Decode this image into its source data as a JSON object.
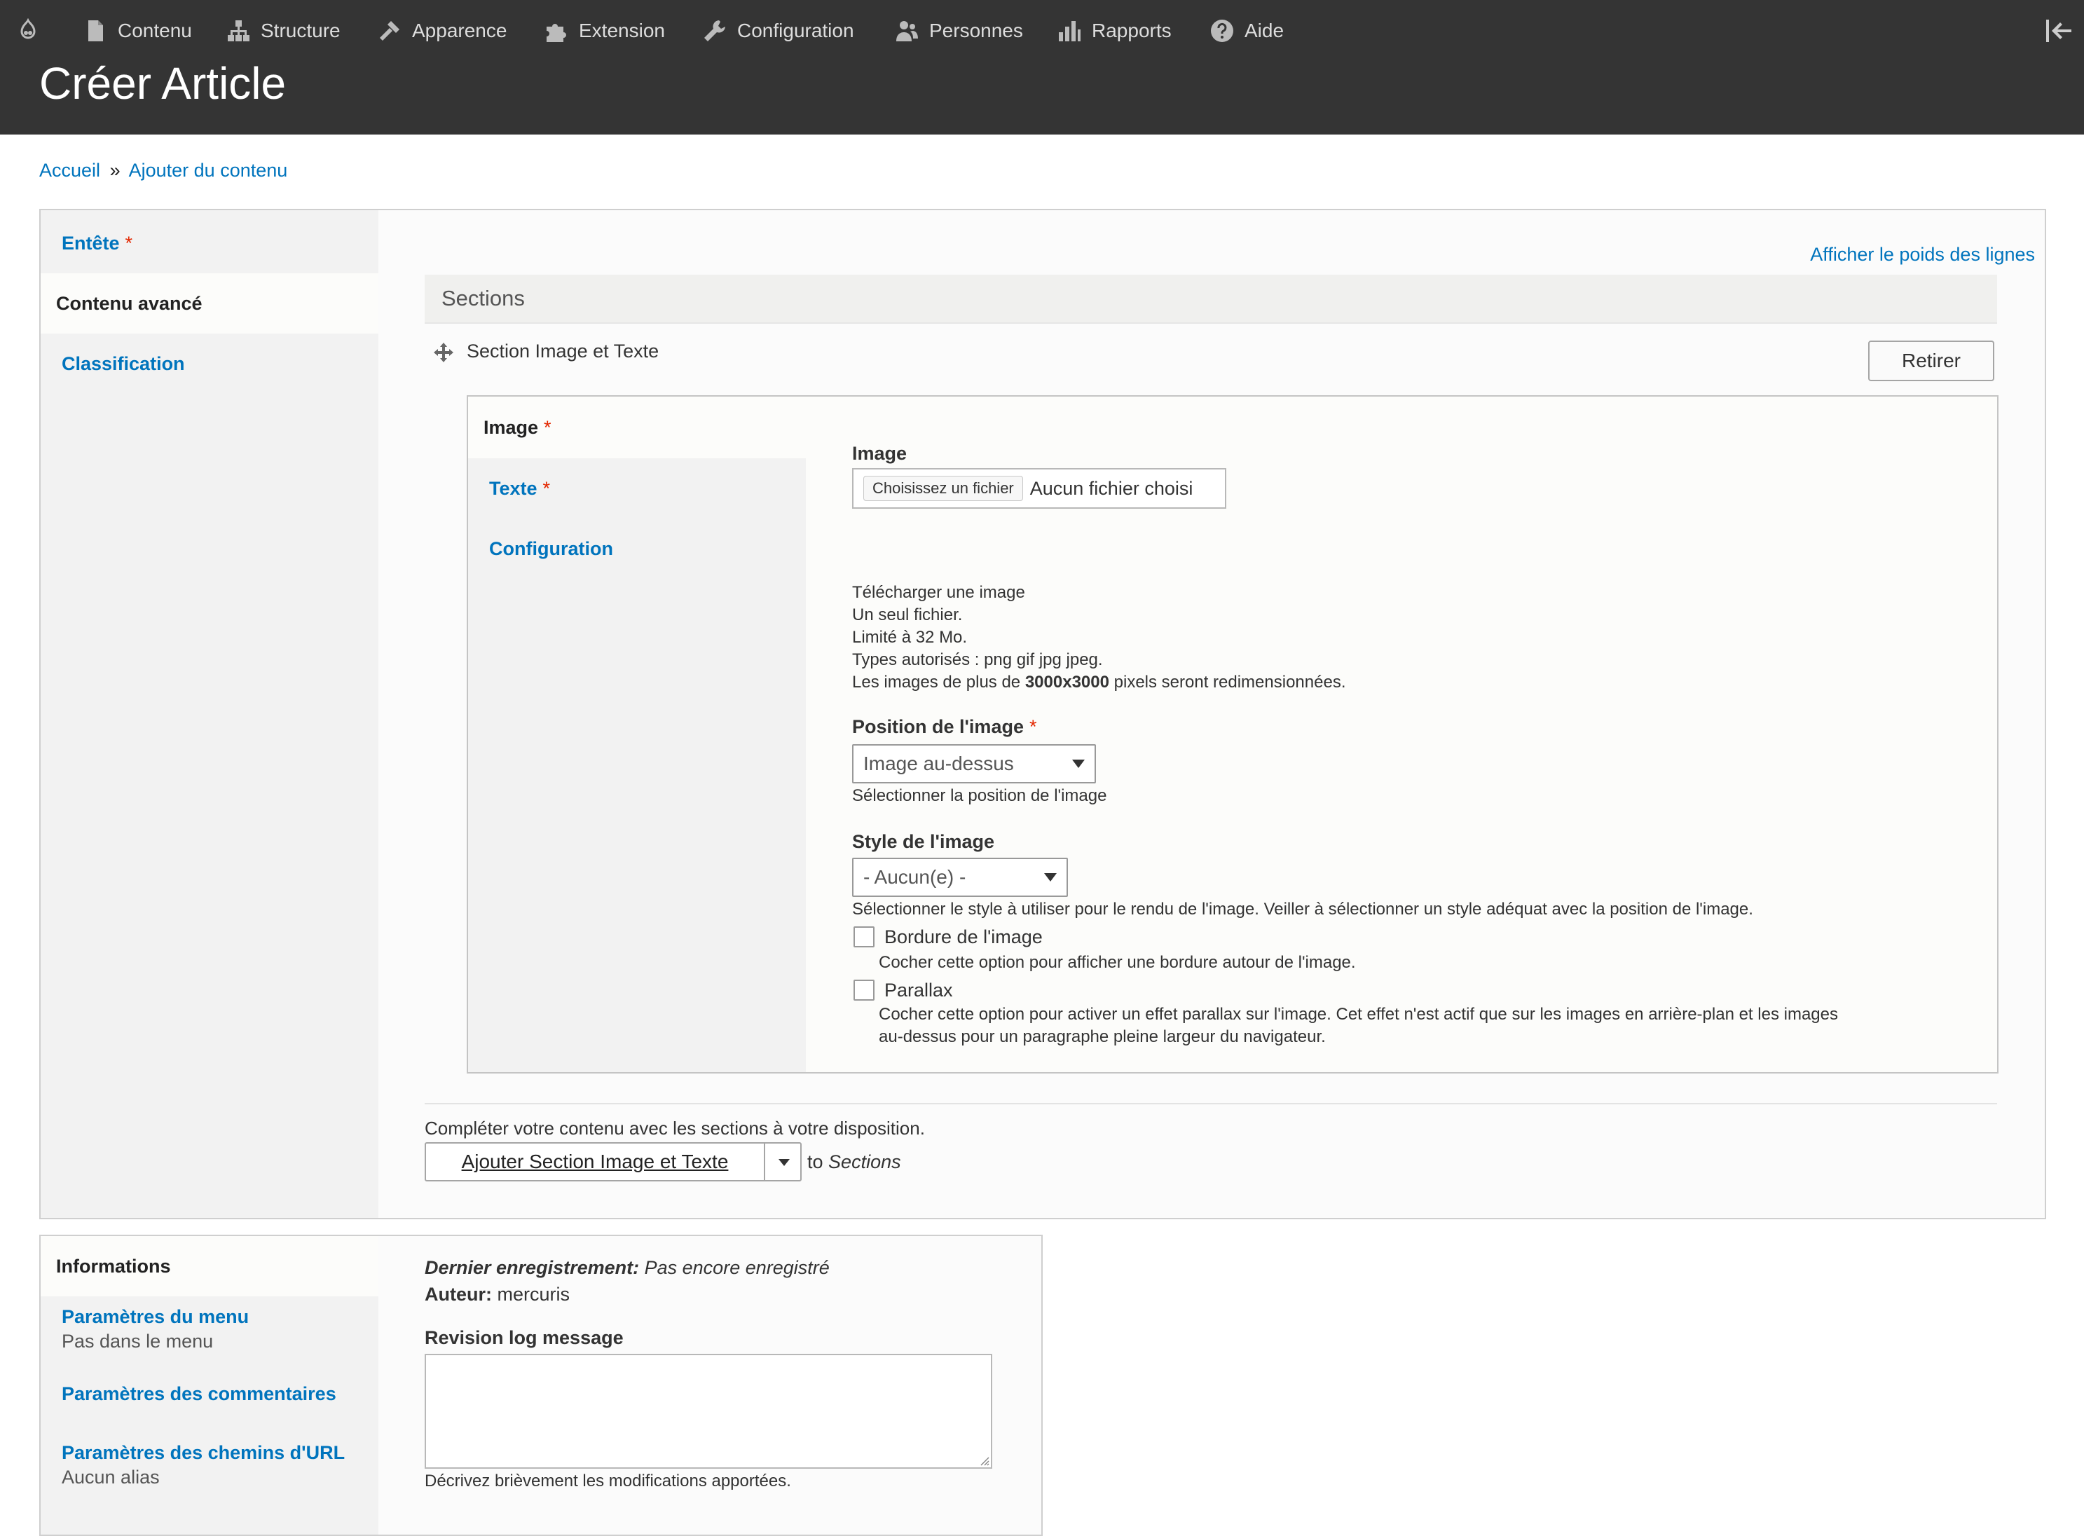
{
  "toolbar": {
    "items": [
      {
        "label": "Contenu",
        "icon": "file-icon"
      },
      {
        "label": "Structure",
        "icon": "sitemap-icon"
      },
      {
        "label": "Apparence",
        "icon": "wrench-brush-icon"
      },
      {
        "label": "Extension",
        "icon": "puzzle-icon"
      },
      {
        "label": "Configuration",
        "icon": "wrench-icon"
      },
      {
        "label": "Personnes",
        "icon": "people-icon"
      },
      {
        "label": "Rapports",
        "icon": "bar-chart-icon"
      },
      {
        "label": "Aide",
        "icon": "help-icon"
      }
    ]
  },
  "header": {
    "title": "Créer Article"
  },
  "breadcrumb": {
    "home": "Accueil",
    "separator": "»",
    "current": "Ajouter du contenu"
  },
  "main_tabs": [
    {
      "label": "Entête",
      "required": "*"
    },
    {
      "label": "Contenu avancé"
    },
    {
      "label": "Classification"
    }
  ],
  "content": {
    "weights_link": "Afficher le poids des lignes",
    "sections_title": "Sections",
    "section_label": "Section Image et Texte",
    "remove_button": "Retirer",
    "inner_tabs": [
      {
        "label": "Image",
        "required": "*"
      },
      {
        "label": "Texte",
        "required": "*"
      },
      {
        "label": "Configuration"
      }
    ],
    "image_field": {
      "label": "Image",
      "file_button": "Choisissez un fichier",
      "file_status": "Aucun fichier choisi",
      "help": [
        "Télécharger une image",
        "Un seul fichier.",
        "Limité à 32 Mo.",
        "Types autorisés : png gif jpg jpeg."
      ],
      "help_dims_prefix": "Les images de plus de",
      "help_dims_value": "3000x3000",
      "help_dims_suffix": "pixels seront redimensionnées."
    },
    "position_field": {
      "label": "Position de l'image",
      "required": "*",
      "value": "Image au-dessus",
      "help": "Sélectionner la position de l'image"
    },
    "style_field": {
      "label": "Style de l'image",
      "value": "- Aucun(e) -",
      "help": "Sélectionner le style à utiliser pour le rendu de l'image. Veiller à sélectionner un style adéquat avec la position de l'image."
    },
    "border_option": {
      "label": "Bordure de l'image",
      "help": "Cocher cette option pour afficher une bordure autour de l'image.",
      "checked": false
    },
    "parallax_option": {
      "label": "Parallax",
      "help_line1": "Cocher cette option pour activer un effet parallax sur l'image. Cet effet n'est actif que sur les images en arrière-plan et les images",
      "help_line2": "au-dessus pour un paragraphe pleine largeur du navigateur.",
      "checked": false
    },
    "complete_text": "Compléter votre contenu avec les sections à votre disposition.",
    "add_button": "Ajouter Section Image et Texte",
    "to_text": "to",
    "to_target": "Sections"
  },
  "details": {
    "tabs": [
      {
        "label": "Informations"
      },
      {
        "label": "Paramètres du menu",
        "summary": "Pas dans le menu"
      },
      {
        "label": "Paramètres des commentaires"
      },
      {
        "label": "Paramètres des chemins d'URL",
        "summary": "Aucun alias"
      }
    ],
    "last_saved_label": "Dernier enregistrement:",
    "last_saved_value": "Pas encore enregistré",
    "author_label": "Auteur:",
    "author_value": "mercuris",
    "revision_label": "Revision log message",
    "revision_help": "Décrivez brièvement les modifications apportées."
  },
  "colors": {
    "toolbar_bg": "#343434",
    "link": "#0074bd",
    "required": "#e32700"
  }
}
